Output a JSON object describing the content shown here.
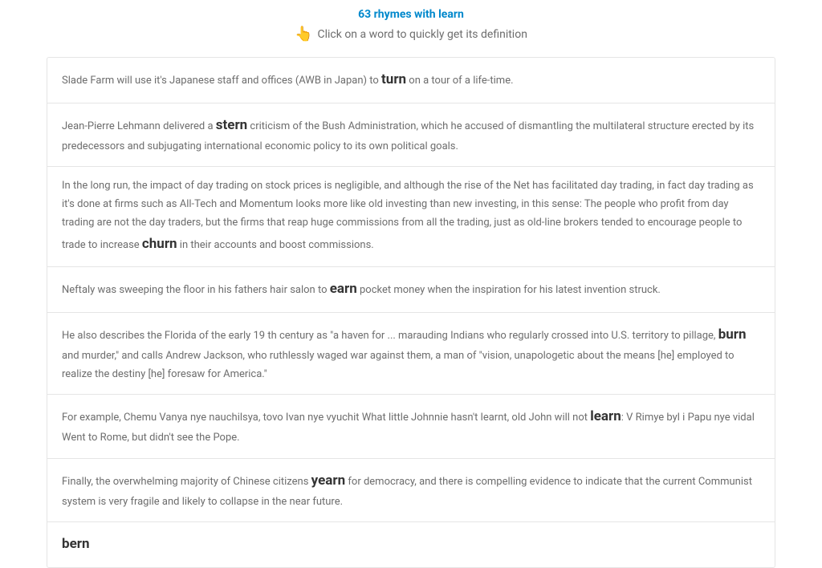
{
  "header": {
    "title": "63 rhymes with learn",
    "subtitle": "Click on a word to quickly get its definition"
  },
  "items": [
    {
      "before": "Slade Farm will use it's Japanese staff and offices (AWB in Japan) to ",
      "word": "turn",
      "after": " on a tour of a life-time."
    },
    {
      "before": "Jean-Pierre Lehmann delivered a ",
      "word": "stern",
      "after": " criticism of the Bush Administration, which he accused of dismantling the multilateral structure erected by its predecessors and subjugating international economic policy to its own political goals."
    },
    {
      "before": "In the long run, the impact of day trading on stock prices is negligible, and although the rise of the Net has facilitated day trading, in fact day trading as it's done at firms such as All-Tech and Momentum looks more like old investing than new investing, in this sense: The people who profit from day trading are not the day traders, but the firms that reap huge commissions from all the trading, just as old-line brokers tended to encourage people to trade to increase ",
      "word": "churn",
      "after": " in their accounts and boost commissions."
    },
    {
      "before": "Neftaly was sweeping the floor in his fathers hair salon to ",
      "word": "earn",
      "after": " pocket money when the inspiration for his latest invention struck."
    },
    {
      "before": "He also describes the Florida of the early 19 th century as \"a haven for ... marauding Indians who regularly crossed into U.S. territory to pillage, ",
      "word": "burn",
      "after": " and murder,\" and calls Andrew Jackson, who ruthlessly waged war against them, a man of \"vision, unapologetic about the means [he] employed to realize the destiny [he] foresaw for America.\""
    },
    {
      "before": "For example, Chemu Vanya nye nauchilsya, tovo Ivan nye vyuchit What little Johnnie hasn't learnt, old John will not ",
      "word": "learn",
      "after": ": V Rimye byl i Papu nye vidal Went to Rome, but didn't see the Pope."
    },
    {
      "before": "Finally, the overwhelming majority of Chinese citizens ",
      "word": "yearn",
      "after": " for democracy, and there is compelling evidence to indicate that the current Communist system is very fragile and likely to collapse in the near future."
    },
    {
      "standalone": "bern"
    }
  ]
}
